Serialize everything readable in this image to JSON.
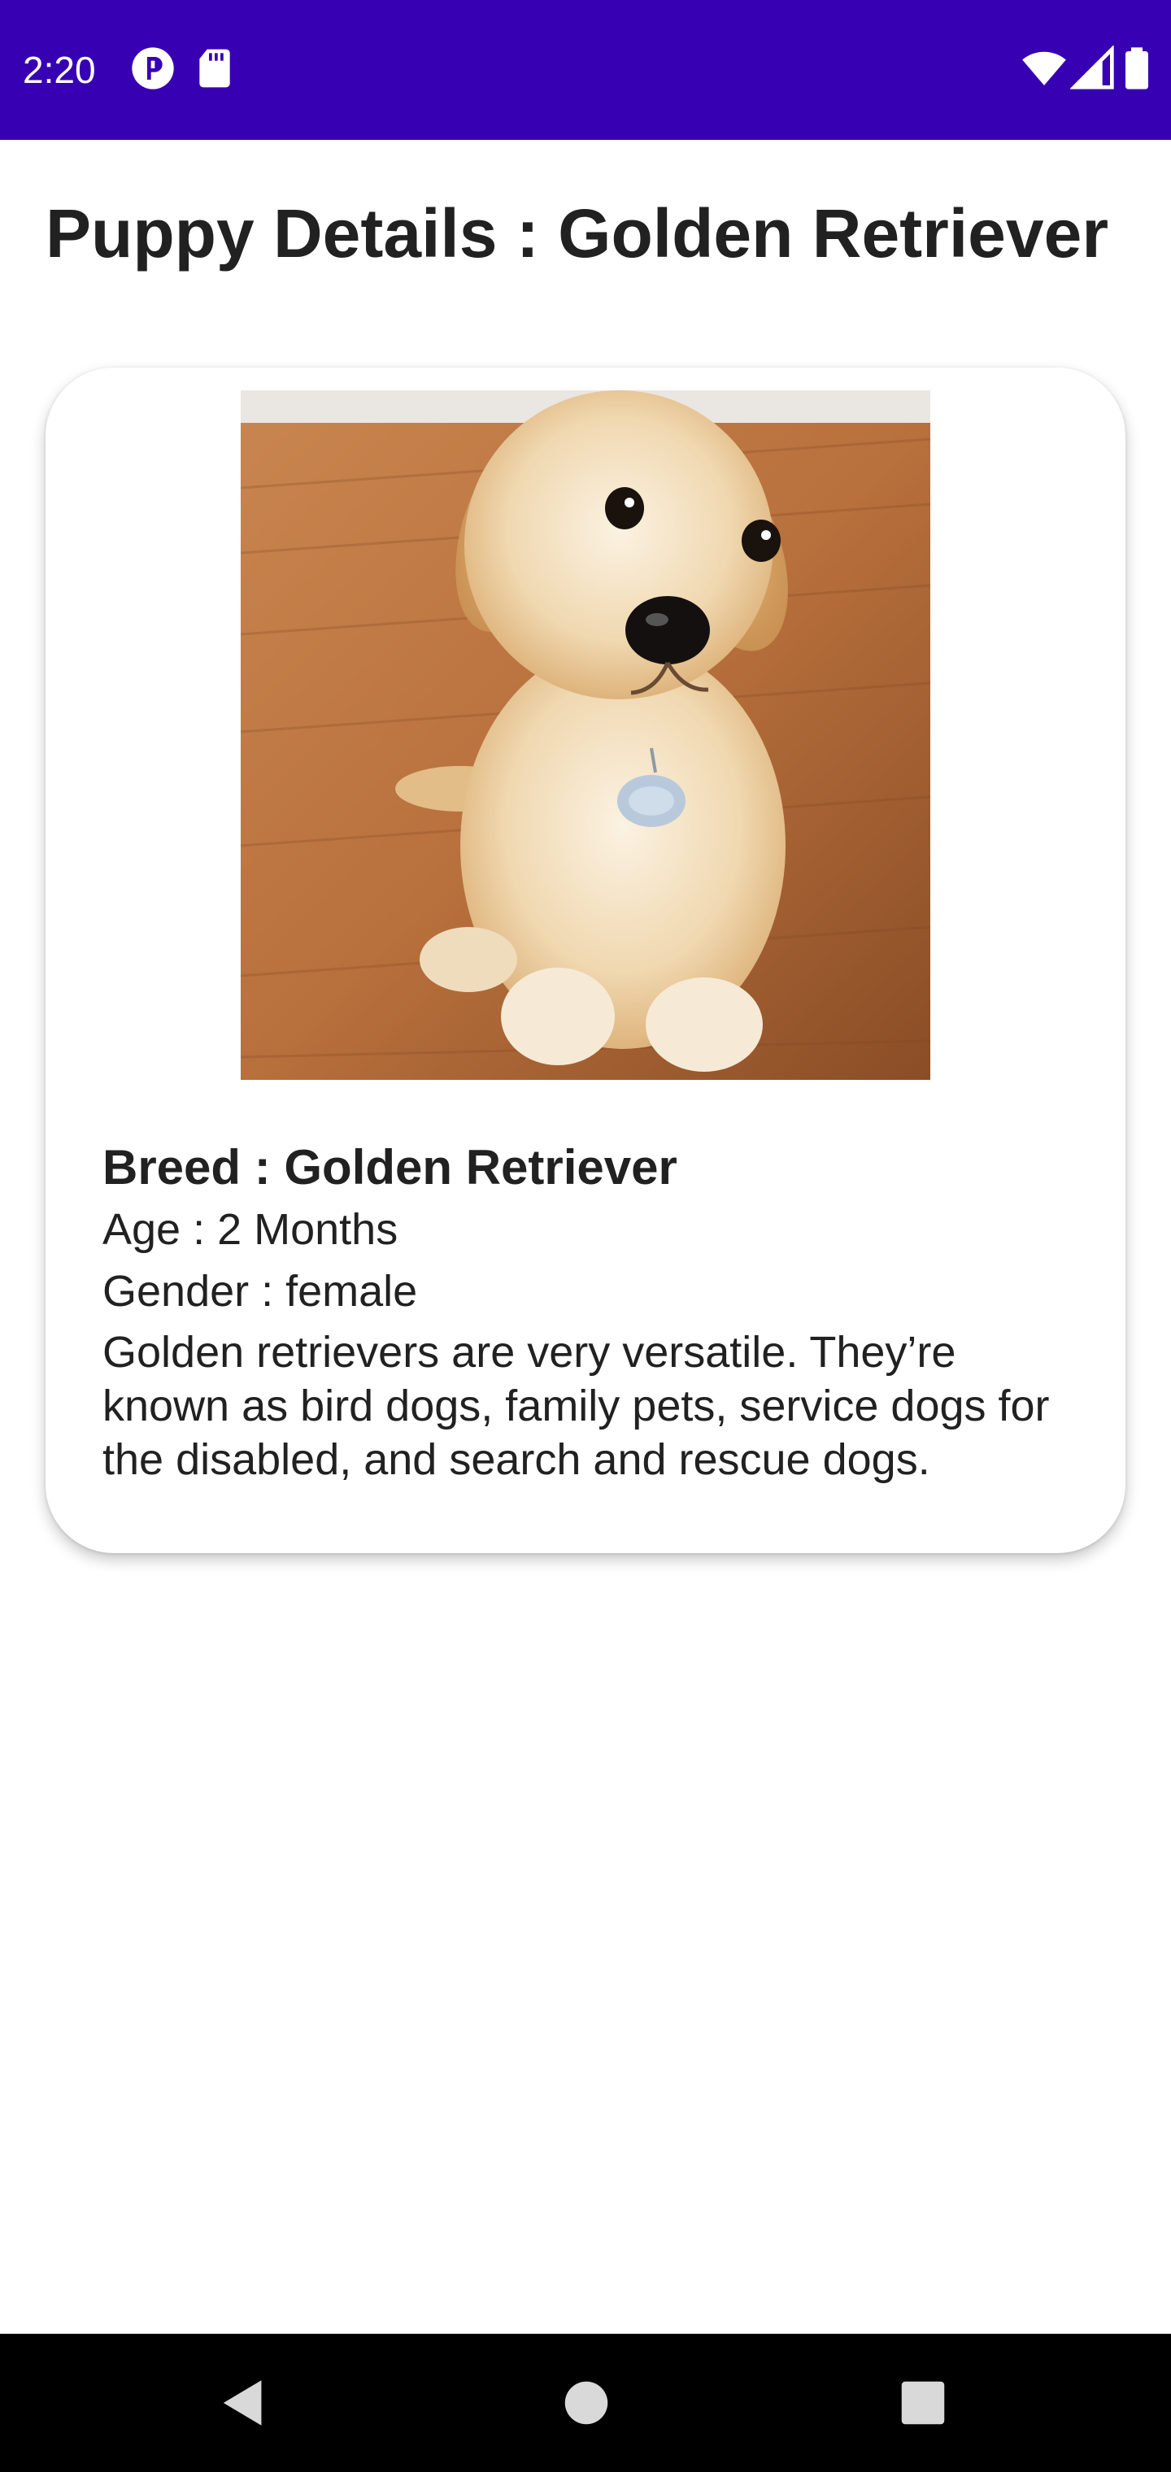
{
  "status_bar": {
    "time": "2:20",
    "background": "#3700b3",
    "icons_left": [
      "app-notification-icon",
      "sd-card-icon"
    ],
    "icons_right": [
      "wifi-icon",
      "cell-signal-icon",
      "battery-icon"
    ]
  },
  "page": {
    "title": "Puppy Details : Golden Retriever"
  },
  "card": {
    "image_subject": "golden-retriever-puppy",
    "breed": "Breed : Golden Retriever",
    "age": "Age : 2 Months",
    "gender": "Gender : female",
    "description": "Golden retrievers are very versatile. They’re known as bird dogs, family pets, service dogs for the disabled, and search and rescue dogs."
  },
  "nav_bar": {
    "buttons": [
      "back-icon",
      "home-icon",
      "recents-icon"
    ]
  }
}
